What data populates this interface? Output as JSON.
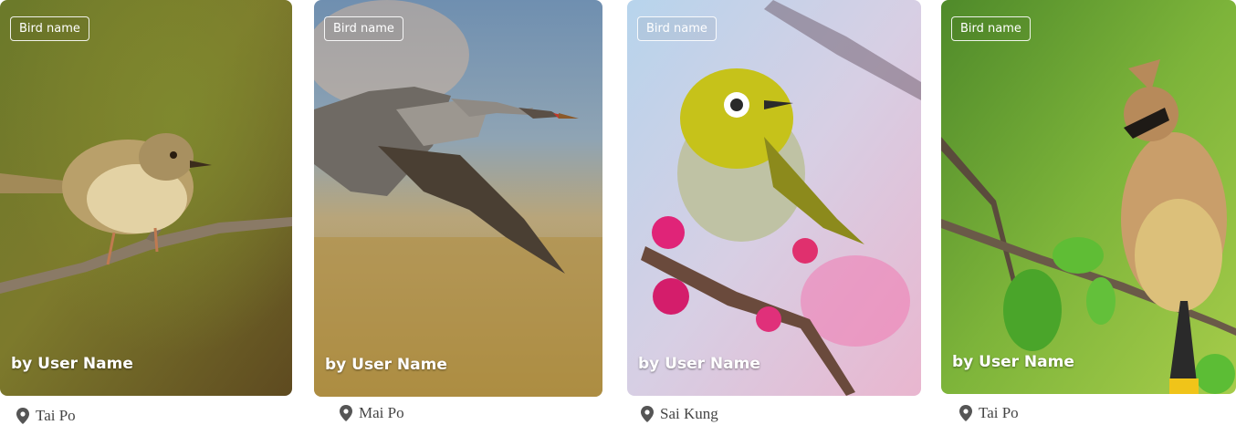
{
  "cards": [
    {
      "badge": "Bird name",
      "byline": "by User Name",
      "location": "Tai Po",
      "pin_icon": "location-pin-icon"
    },
    {
      "badge": "Bird name",
      "byline": "by User Name",
      "location": "Mai Po",
      "pin_icon": "location-pin-icon"
    },
    {
      "badge": "Bird name",
      "byline": "by User Name",
      "location": "Sai Kung",
      "pin_icon": "location-pin-icon"
    },
    {
      "badge": "Bird name",
      "byline": "by User Name",
      "location": "Tai Po",
      "pin_icon": "location-pin-icon"
    }
  ],
  "colors": {
    "pin": "#555555",
    "badge_border": "#ffffff",
    "text": "#444444"
  }
}
